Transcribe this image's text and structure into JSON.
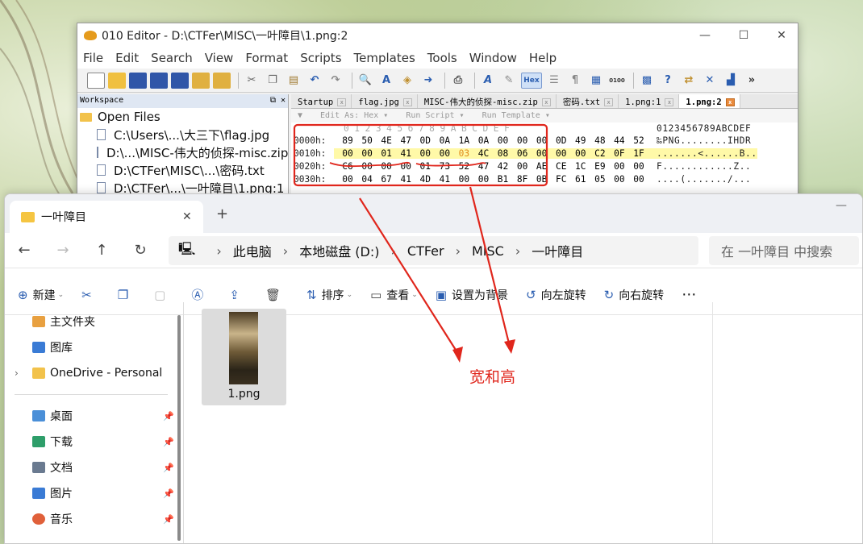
{
  "editor": {
    "title": "010 Editor - D:\\CTFer\\MISC\\一叶障目\\1.png:2",
    "menu": [
      "File",
      "Edit",
      "Search",
      "View",
      "Format",
      "Scripts",
      "Templates",
      "Tools",
      "Window",
      "Help"
    ],
    "workspace": {
      "title": "Workspace",
      "section": "Open Files",
      "files": [
        "C:\\Users\\...\\大三下\\flag.jpg",
        "D:\\...\\MISC-伟大的侦探-misc.zip",
        "D:\\CTFer\\MISC\\...\\密码.txt",
        "D:\\CTFer\\...\\一叶障目\\1.png:1"
      ]
    },
    "tabs": [
      "Startup",
      "flag.jpg",
      "MISC-伟大的侦探-misc.zip",
      "密码.txt",
      "1.png:1",
      "1.png:2"
    ],
    "edit_as": [
      "Edit As: Hex ▾",
      "Run Script ▾",
      "Run Template ▾"
    ],
    "col_header": "0  1  2  3  4  5  6  7  8  9  A  B  C  D  E  F",
    "col_ascii": "0123456789ABCDEF",
    "rows": [
      {
        "addr": "0000h:",
        "bytes": [
          "89",
          "50",
          "4E",
          "47",
          "0D",
          "0A",
          "1A",
          "0A",
          "00",
          "00",
          "00",
          "0D",
          "49",
          "48",
          "44",
          "52"
        ],
        "ascii": "‰PNG........IHDR"
      },
      {
        "addr": "0010h:",
        "bytes": [
          "00",
          "00",
          "01",
          "41",
          "00",
          "00",
          "03",
          "4C",
          "08",
          "06",
          "00",
          "00",
          "00",
          "C2",
          "0F",
          "1F"
        ],
        "ascii": ".......<......B.."
      },
      {
        "addr": "0020h:",
        "bytes": [
          "C6",
          "00",
          "00",
          "00",
          "01",
          "73",
          "52",
          "47",
          "42",
          "00",
          "AE",
          "CE",
          "1C",
          "E9",
          "00",
          "00"
        ],
        "ascii": "F............Z.."
      },
      {
        "addr": "0030h:",
        "bytes": [
          "00",
          "04",
          "67",
          "41",
          "4D",
          "41",
          "00",
          "00",
          "B1",
          "8F",
          "0B",
          "FC",
          "61",
          "05",
          "00",
          "00"
        ],
        "ascii": "....(......./..."
      }
    ]
  },
  "explorer": {
    "tab_title": "一叶障目",
    "breadcrumb": [
      "此电脑",
      "本地磁盘 (D:)",
      "CTFer",
      "MISC",
      "一叶障目"
    ],
    "search_placeholder": "在 一叶障目 中搜索",
    "commands": [
      "新建",
      "排序",
      "查看",
      "设置为背景",
      "向左旋转",
      "向右旋转"
    ],
    "sidebar": [
      {
        "label": "主文件夹",
        "pin": false
      },
      {
        "label": "图库",
        "pin": false
      },
      {
        "label": "OneDrive - Personal",
        "pin": false
      },
      {
        "label": "桌面",
        "pin": true
      },
      {
        "label": "下载",
        "pin": true
      },
      {
        "label": "文档",
        "pin": true
      },
      {
        "label": "图片",
        "pin": true
      },
      {
        "label": "音乐",
        "pin": true
      }
    ],
    "file": {
      "name": "1.png"
    }
  },
  "annotation": "宽和高",
  "colors": {
    "annotation": "#e0261c",
    "highlight": "#fff9a8"
  }
}
